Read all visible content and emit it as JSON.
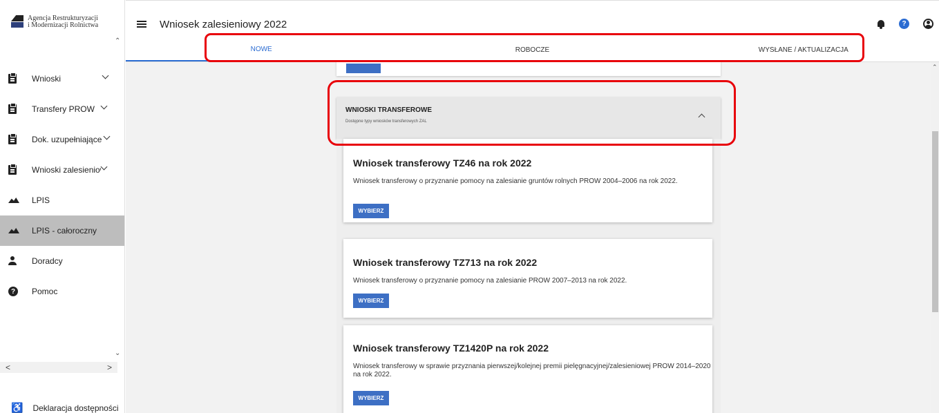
{
  "brand": {
    "line1": "Agencja Restrukturyzacji",
    "line2": "i Modernizacji Rolnictwa"
  },
  "header": {
    "title": "Wniosek zalesieniowy 2022"
  },
  "tabs": [
    {
      "label": "NOWE",
      "active": true
    },
    {
      "label": "ROBOCZE",
      "active": false
    },
    {
      "label": "WYSŁANE / AKTUALIZACJA",
      "active": false
    }
  ],
  "sidebar": {
    "items": [
      {
        "label": "Wnioski",
        "icon": "clipboard-icon",
        "expandable": true
      },
      {
        "label": "Transfery PROW",
        "icon": "clipboard-icon",
        "expandable": true
      },
      {
        "label": "Dok. uzupełniające",
        "icon": "clipboard-icon",
        "expandable": true
      },
      {
        "label": "Wnioski zalesieniowe",
        "icon": "clipboard-icon",
        "expandable": true
      },
      {
        "label": "LPIS",
        "icon": "terrain-icon",
        "expandable": false
      },
      {
        "label": "LPIS - całoroczny",
        "icon": "terrain-icon",
        "expandable": false,
        "active": true
      },
      {
        "label": "Doradcy",
        "icon": "person-icon",
        "expandable": false
      },
      {
        "label": "Pomoc",
        "icon": "help-icon",
        "expandable": false
      }
    ],
    "accessibility": "Deklaracja dostępności"
  },
  "panel": {
    "title": "WNIOSKI TRANSFEROWE",
    "subtitle": "Dostępne typy wniosków transferowych ZAL"
  },
  "cards": [
    {
      "title": "Wniosek transferowy TZ46 na rok 2022",
      "description": "Wniosek transferowy o przyznanie pomocy na zalesianie gruntów rolnych PROW 2004–2006 na rok 2022.",
      "button": "WYBIERZ"
    },
    {
      "title": "Wniosek transferowy TZ713 na rok 2022",
      "description": "Wniosek transferowy o przyznanie pomocy na zalesianie PROW 2007–2013 na rok 2022.",
      "button": "WYBIERZ"
    },
    {
      "title": "Wniosek transferowy TZ1420P na rok 2022",
      "description": "Wniosek transferowy w sprawie przyznania pierwszej/kolejnej premii pielęgnacyjnej/zalesieniowej PROW 2014–2020 na rok 2022.",
      "button": "WYBIERZ"
    }
  ],
  "colors": {
    "accent": "#2b6cd2",
    "button": "#3d6fc4",
    "highlight": "#e8000a"
  }
}
